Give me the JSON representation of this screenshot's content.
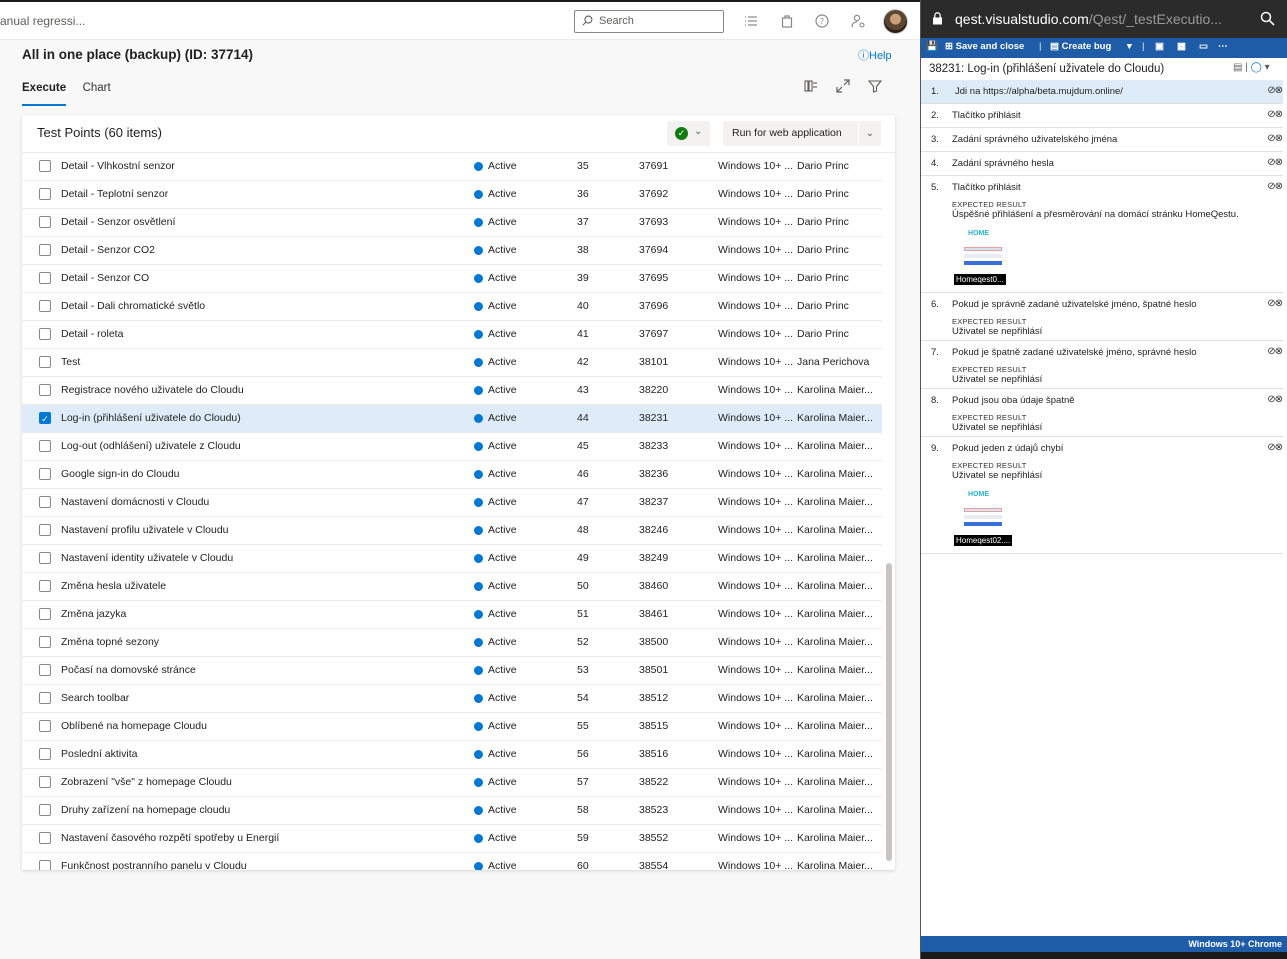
{
  "topbar": {
    "breadcrumb": "anual regressi...",
    "search_placeholder": "Search"
  },
  "page": {
    "title": "All in one place (backup) (ID: 37714)",
    "help": "Help",
    "tabs": [
      "Execute",
      "Chart"
    ]
  },
  "panel": {
    "title": "Test Points (60 items)",
    "run_button": "Run for web application"
  },
  "rows": [
    {
      "title": "Detail - Vlhkostní senzor",
      "state": "Active",
      "order": "35",
      "id": "37691",
      "config": "Windows 10+ ...",
      "tester": "Dario Princ",
      "checked": false
    },
    {
      "title": "Detail - Teplotní senzor",
      "state": "Active",
      "order": "36",
      "id": "37692",
      "config": "Windows 10+ ...",
      "tester": "Dario Princ",
      "checked": false
    },
    {
      "title": "Detail - Senzor osvětlení",
      "state": "Active",
      "order": "37",
      "id": "37693",
      "config": "Windows 10+ ...",
      "tester": "Dario Princ",
      "checked": false
    },
    {
      "title": "Detail - Senzor CO2",
      "state": "Active",
      "order": "38",
      "id": "37694",
      "config": "Windows 10+ ...",
      "tester": "Dario Princ",
      "checked": false
    },
    {
      "title": "Detail - Senzor CO",
      "state": "Active",
      "order": "39",
      "id": "37695",
      "config": "Windows 10+ ...",
      "tester": "Dario Princ",
      "checked": false
    },
    {
      "title": "Detail - Dali chromatické světlo",
      "state": "Active",
      "order": "40",
      "id": "37696",
      "config": "Windows 10+ ...",
      "tester": "Dario Princ",
      "checked": false
    },
    {
      "title": "Detail - roleta",
      "state": "Active",
      "order": "41",
      "id": "37697",
      "config": "Windows 10+ ...",
      "tester": "Dario Princ",
      "checked": false
    },
    {
      "title": "Test",
      "state": "Active",
      "order": "42",
      "id": "38101",
      "config": "Windows 10+ ...",
      "tester": "Jana Perichova",
      "checked": false
    },
    {
      "title": "Registrace nového uživatele do Cloudu",
      "state": "Active",
      "order": "43",
      "id": "38220",
      "config": "Windows 10+ ...",
      "tester": "Karolina Maier...",
      "checked": false
    },
    {
      "title": "Log-in (přihlášení uživatele do Cloudu)",
      "state": "Active",
      "order": "44",
      "id": "38231",
      "config": "Windows 10+ ...",
      "tester": "Karolina Maier...",
      "checked": true
    },
    {
      "title": "Log-out (odhlášení) uživatele z Cloudu",
      "state": "Active",
      "order": "45",
      "id": "38233",
      "config": "Windows 10+ ...",
      "tester": "Karolina Maier...",
      "checked": false
    },
    {
      "title": "Google sign-in do Cloudu",
      "state": "Active",
      "order": "46",
      "id": "38236",
      "config": "Windows 10+ ...",
      "tester": "Karolina Maier...",
      "checked": false
    },
    {
      "title": "Nastavení domácnosti v Cloudu",
      "state": "Active",
      "order": "47",
      "id": "38237",
      "config": "Windows 10+ ...",
      "tester": "Karolina Maier...",
      "checked": false
    },
    {
      "title": "Nastavení profilu uživatele v Cloudu",
      "state": "Active",
      "order": "48",
      "id": "38246",
      "config": "Windows 10+ ...",
      "tester": "Karolina Maier...",
      "checked": false
    },
    {
      "title": "Nastavení identity uživatele v Cloudu",
      "state": "Active",
      "order": "49",
      "id": "38249",
      "config": "Windows 10+ ...",
      "tester": "Karolina Maier...",
      "checked": false
    },
    {
      "title": "Změna hesla uživatele",
      "state": "Active",
      "order": "50",
      "id": "38460",
      "config": "Windows 10+ ...",
      "tester": "Karolina Maier...",
      "checked": false
    },
    {
      "title": "Změna jazyka",
      "state": "Active",
      "order": "51",
      "id": "38461",
      "config": "Windows 10+ ...",
      "tester": "Karolina Maier...",
      "checked": false
    },
    {
      "title": "Změna topné sezony",
      "state": "Active",
      "order": "52",
      "id": "38500",
      "config": "Windows 10+ ...",
      "tester": "Karolina Maier...",
      "checked": false
    },
    {
      "title": "Počasí na domovské stránce",
      "state": "Active",
      "order": "53",
      "id": "38501",
      "config": "Windows 10+ ...",
      "tester": "Karolina Maier...",
      "checked": false
    },
    {
      "title": "Search toolbar",
      "state": "Active",
      "order": "54",
      "id": "38512",
      "config": "Windows 10+ ...",
      "tester": "Karolina Maier...",
      "checked": false
    },
    {
      "title": "Oblíbené na homepage Cloudu",
      "state": "Active",
      "order": "55",
      "id": "38515",
      "config": "Windows 10+ ...",
      "tester": "Karolina Maier...",
      "checked": false
    },
    {
      "title": "Poslední aktivita",
      "state": "Active",
      "order": "56",
      "id": "38516",
      "config": "Windows 10+ ...",
      "tester": "Karolina Maier...",
      "checked": false
    },
    {
      "title": "Zobrazení \"vše\" z homepage Cloudu",
      "state": "Active",
      "order": "57",
      "id": "38522",
      "config": "Windows 10+ ...",
      "tester": "Karolina Maier...",
      "checked": false
    },
    {
      "title": "Druhy zařízení na homepage cloudu",
      "state": "Active",
      "order": "58",
      "id": "38523",
      "config": "Windows 10+ ...",
      "tester": "Karolina Maier...",
      "checked": false
    },
    {
      "title": "Nastavení časového rozpětí spotřeby u Energií",
      "state": "Active",
      "order": "59",
      "id": "38552",
      "config": "Windows 10+ ...",
      "tester": "Karolina Maier...",
      "checked": false
    },
    {
      "title": "Funkčnost postranního panelu v Cloudu",
      "state": "Active",
      "order": "60",
      "id": "38554",
      "config": "Windows 10+ ...",
      "tester": "Karolina Maier...",
      "checked": false
    }
  ],
  "runner": {
    "url_host": "qest.visualstudio.com",
    "url_path": "/Qest/_testExecutio...",
    "save_close": "Save and close",
    "create_bug": "Create bug",
    "case_title": "38231: Log-in (přihlášení uživatele do Cloudu)",
    "expected_label": "EXPECTED RESULT",
    "status": "Windows 10+ Chrome",
    "steps": [
      {
        "num": "1.",
        "text": "Jdi na https://alpha/beta.mujdum.online/"
      },
      {
        "num": "2.",
        "text": "Tlačítko přihlásit"
      },
      {
        "num": "3.",
        "text": "Zadání správného uživatelského jména"
      },
      {
        "num": "4.",
        "text": "Zadání správného hesla"
      },
      {
        "num": "5.",
        "text": "Tlačítko přihlásit",
        "expected": "Úspěšné přihlášení a přesměrování na domácí stránku HomeQestu.",
        "attachment": "Homeqest0..."
      },
      {
        "num": "6.",
        "text": "Pokud je správně zadané uživatelské jméno, špatné heslo",
        "expected": "Uživatel se nepřihlásí"
      },
      {
        "num": "7.",
        "text": "Pokud je špatně zadané uživatelské jméno, správné heslo",
        "expected": "Uživatel se nepřihlásí"
      },
      {
        "num": "8.",
        "text": "Pokud jsou oba údaje špatně",
        "expected": "Uživatel se nepřihlásí"
      },
      {
        "num": "9.",
        "text": "Pokud jeden z údajů chybí",
        "expected": "Uživatel se nepřihlásí",
        "attachment": "Homeqest02...."
      }
    ]
  },
  "colors": {
    "accent": "#0078d4",
    "runner_bar": "#1f5ca8",
    "passed": "#107c10"
  }
}
